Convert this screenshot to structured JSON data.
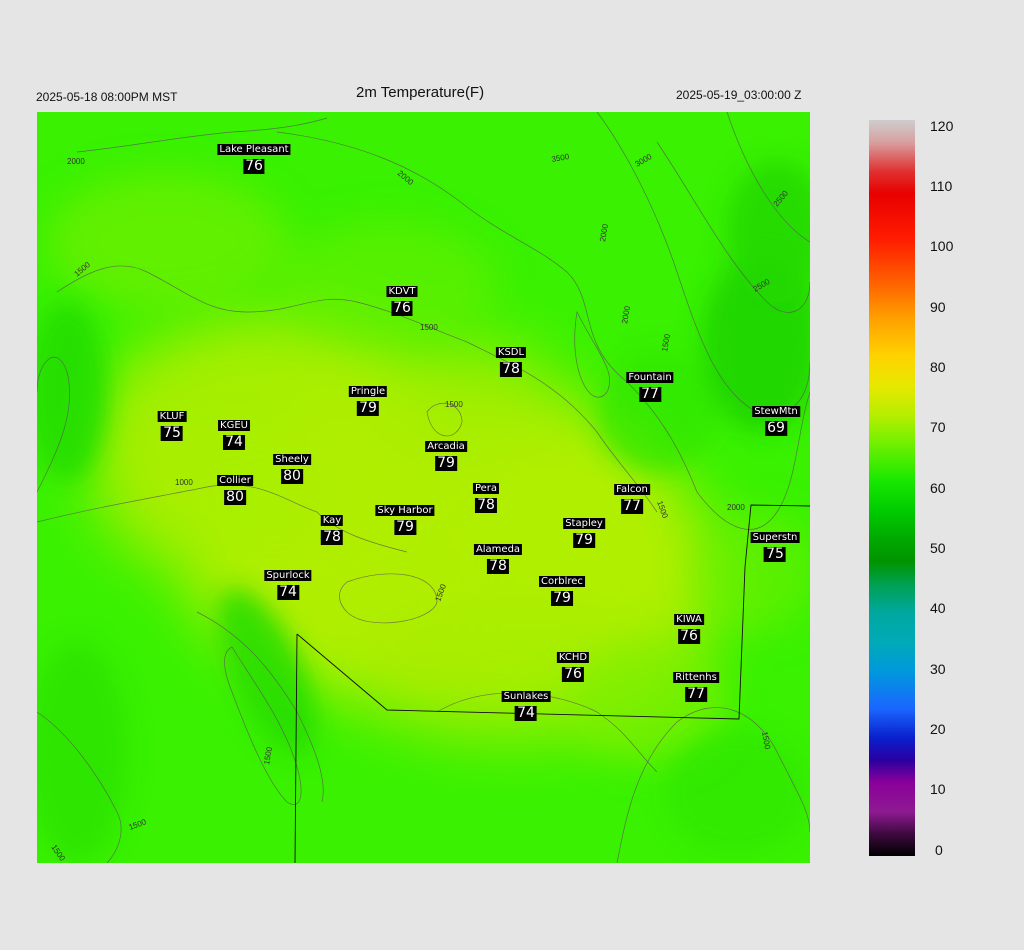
{
  "header": {
    "valid_local": "2025-05-18 08:00PM MST",
    "title": "2m Temperature(F)",
    "valid_utc": "2025-05-19_03:00:00 Z"
  },
  "colorbar": {
    "labels": [
      "120",
      "110",
      "100",
      "90",
      "80",
      "70",
      "60",
      "50",
      "40",
      "30",
      "20",
      "10",
      "0"
    ]
  },
  "contour_labels": [
    "2000",
    "1500",
    "1000",
    "2500",
    "3000",
    "3500"
  ],
  "stations": [
    {
      "name": "Lake Pleasant",
      "value": "76"
    },
    {
      "name": "KDVT",
      "value": "76"
    },
    {
      "name": "KSDL",
      "value": "78"
    },
    {
      "name": "Fountain",
      "value": "77"
    },
    {
      "name": "Pringle",
      "value": "79"
    },
    {
      "name": "KLUF",
      "value": "75"
    },
    {
      "name": "KGEU",
      "value": "74"
    },
    {
      "name": "StewMtn",
      "value": "69"
    },
    {
      "name": "Arcadia",
      "value": "79"
    },
    {
      "name": "Sheely",
      "value": "80"
    },
    {
      "name": "Collier",
      "value": "80"
    },
    {
      "name": "Pera",
      "value": "78"
    },
    {
      "name": "Falcon",
      "value": "77"
    },
    {
      "name": "Kay",
      "value": "78"
    },
    {
      "name": "Sky Harbor",
      "value": "79"
    },
    {
      "name": "Stapley",
      "value": "79"
    },
    {
      "name": "Superstn",
      "value": "75"
    },
    {
      "name": "Alameda",
      "value": "78"
    },
    {
      "name": "Spurlock",
      "value": "74"
    },
    {
      "name": "Corblrec",
      "value": "79"
    },
    {
      "name": "KIWA",
      "value": "76"
    },
    {
      "name": "KCHD",
      "value": "76"
    },
    {
      "name": "Rittenhs",
      "value": "77"
    },
    {
      "name": "Sunlakes",
      "value": "74"
    }
  ]
}
